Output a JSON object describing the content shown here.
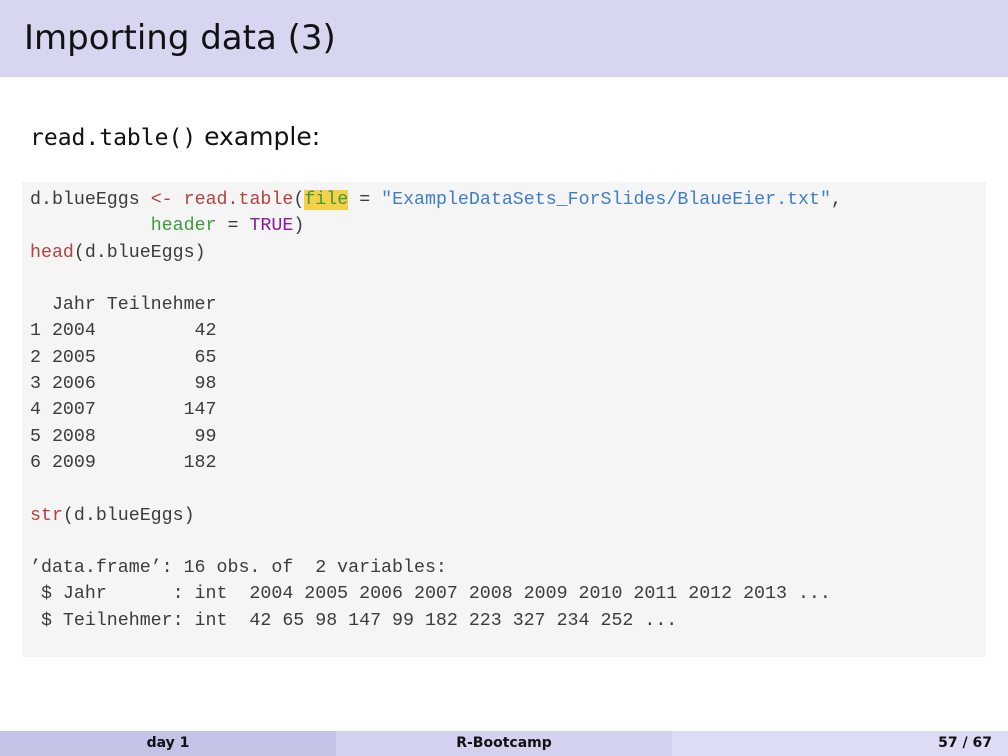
{
  "slide": {
    "title": "Importing data (3)",
    "subtitle_code": "read.table()",
    "subtitle_text": " example:"
  },
  "code": {
    "l1_var": "d.blueEggs ",
    "l1_assign": "<-",
    "l1_sp": " ",
    "l1_fn": "read.table",
    "l1_paren": "(",
    "l1_arg": "file",
    "l1_eq": " = ",
    "l1_str": "\"ExampleDataSets_ForSlides/BlaueEier.txt\"",
    "l1_end": ",",
    "l2_indent": "           ",
    "l2_arg": "header",
    "l2_eq": " = ",
    "l2_kw": "TRUE",
    "l2_end": ")",
    "l3_fn": "head",
    "l3_rest": "(d.blueEggs)",
    "head_output": [
      "  Jahr Teilnehmer",
      "1 2004         42",
      "2 2005         65",
      "3 2006         98",
      "4 2007        147",
      "5 2008         99",
      "6 2009        182"
    ],
    "l4_fn": "str",
    "l4_rest": "(d.blueEggs)",
    "str_output": [
      "’data.frame’: 16 obs. of  2 variables:",
      " $ Jahr      : int  2004 2005 2006 2007 2008 2009 2010 2011 2012 2013 ...",
      " $ Teilnehmer: int  42 65 98 147 99 182 223 327 234 252 ..."
    ]
  },
  "footer": {
    "left": "day 1",
    "center": "R-Bootcamp",
    "right": "57 / 67"
  }
}
